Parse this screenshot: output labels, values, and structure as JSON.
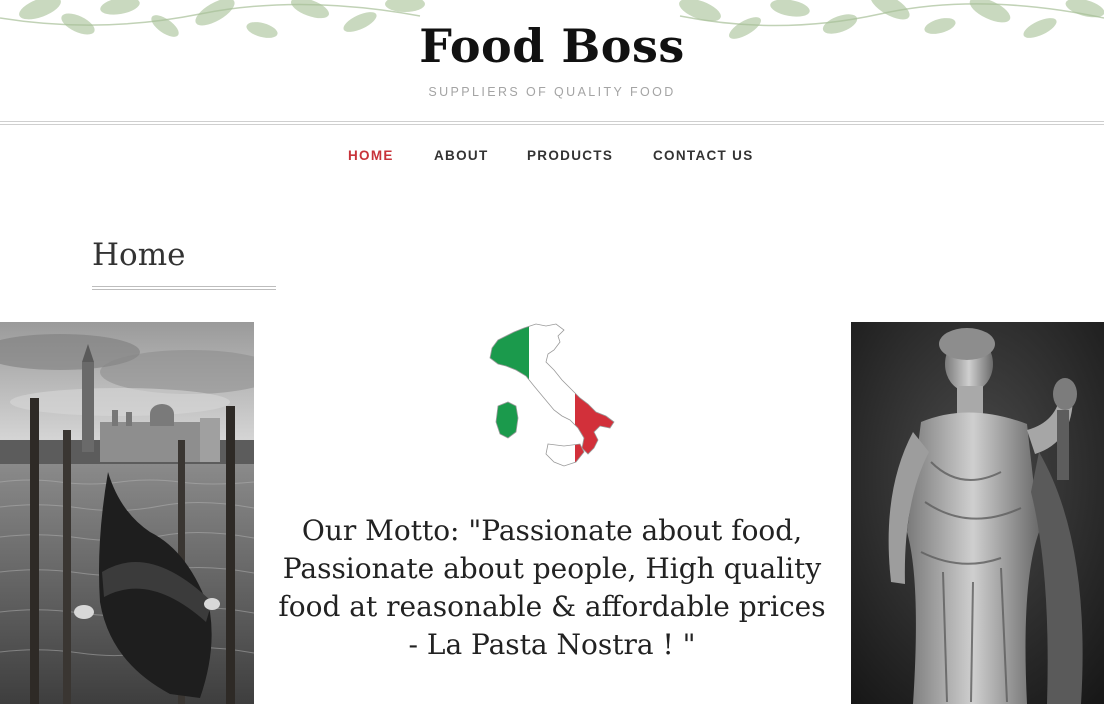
{
  "site": {
    "title": "Food Boss",
    "tagline": "SUPPLIERS OF QUALITY FOOD"
  },
  "nav": {
    "items": [
      {
        "label": "HOME",
        "active": true
      },
      {
        "label": "ABOUT",
        "active": false
      },
      {
        "label": "PRODUCTS",
        "active": false
      },
      {
        "label": "CONTACT US",
        "active": false
      }
    ],
    "active_color": "#c8333a"
  },
  "main": {
    "heading": "Home",
    "motto": "Our Motto: \"Passionate about food, Passionate about people, High quality food at reasonable & affordable prices - La Pasta Nostra ! \""
  },
  "images": {
    "left": "venice-gondola-photo",
    "center": "italy-flag-map",
    "right": "classical-statue-photo"
  },
  "colors": {
    "italy_green": "#1b9a4c",
    "italy_red": "#d2303a",
    "foliage": "#b8cdaa"
  }
}
